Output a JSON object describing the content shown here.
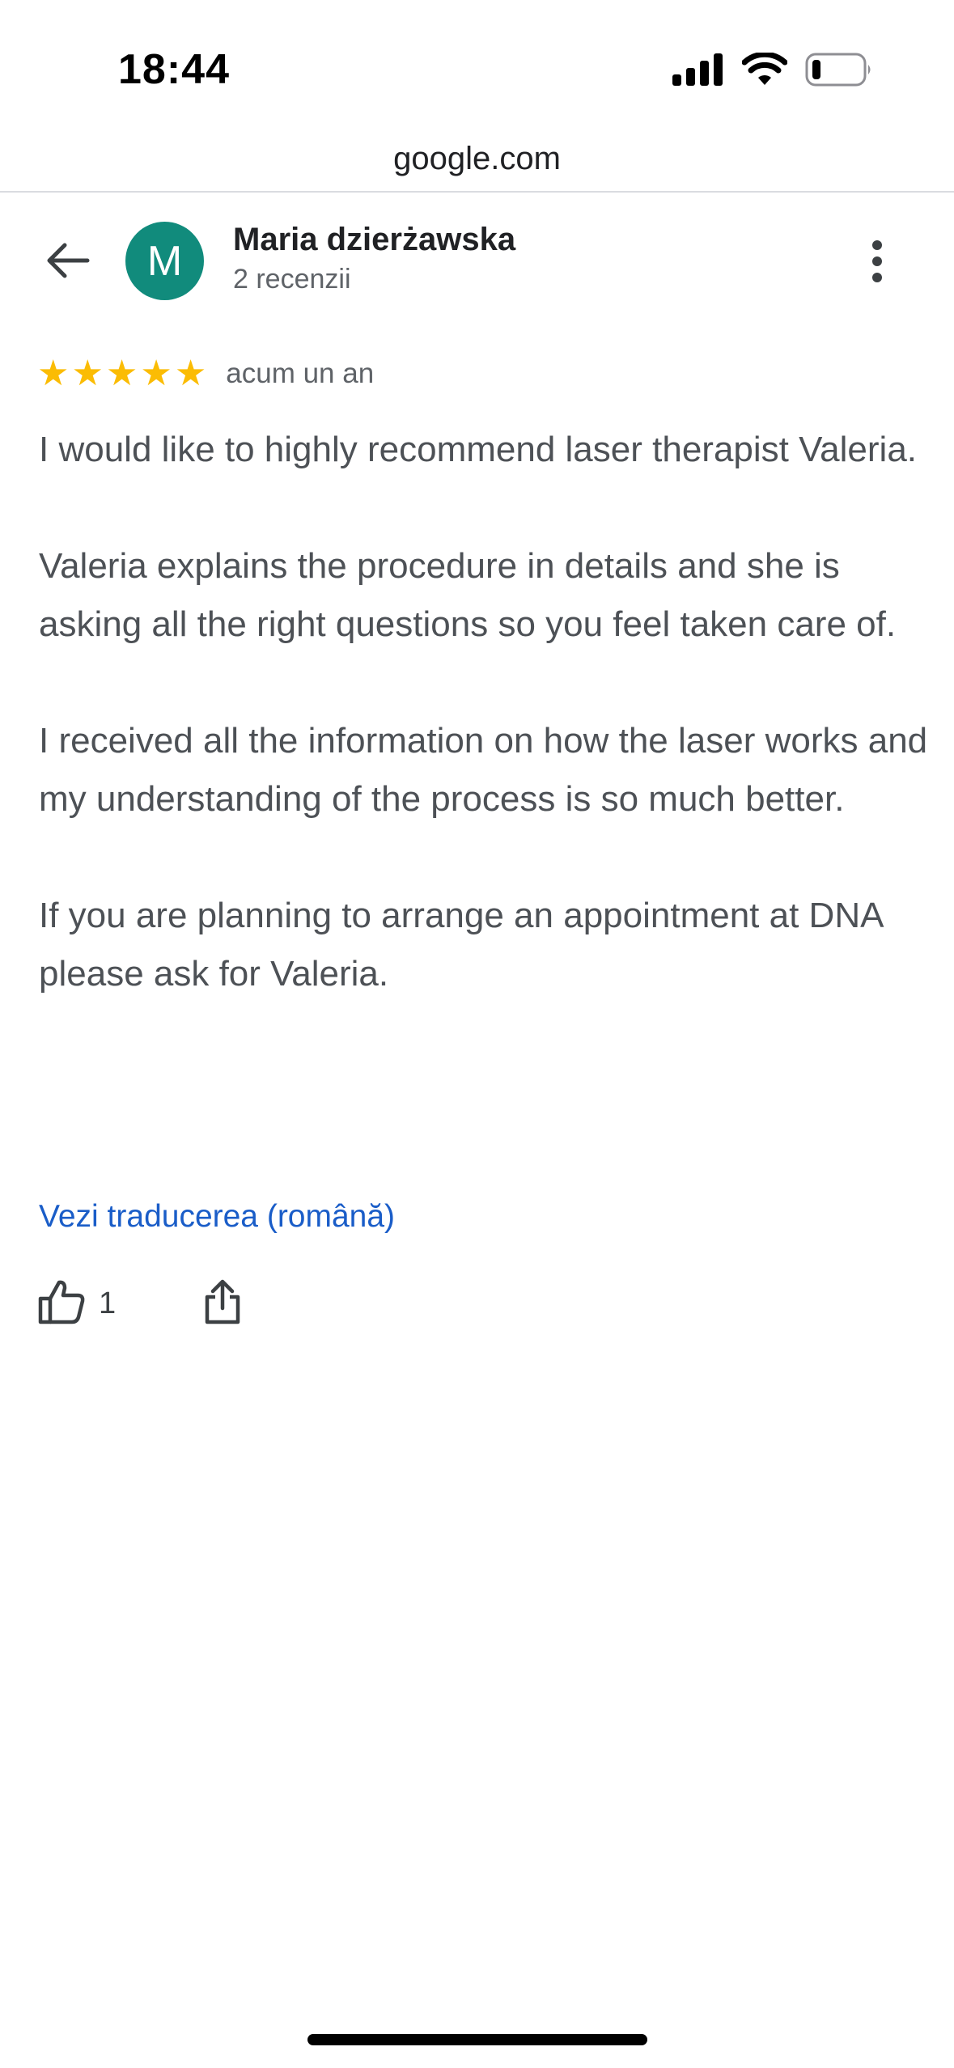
{
  "status_bar": {
    "time": "18:44",
    "icons": [
      "cellular-signal-icon",
      "wifi-icon",
      "battery-icon"
    ]
  },
  "url_bar": {
    "domain": "google.com"
  },
  "header": {
    "back_icon": "arrow-left-icon",
    "avatar_letter": "M",
    "avatar_color": "#118b7c",
    "reviewer_name": "Maria dzierżawska",
    "review_count": "2 recenzii",
    "more_icon": "more-vert-icon"
  },
  "review": {
    "rating": 5,
    "rating_max": 5,
    "star_color": "#fbbc04",
    "date": "acum un an",
    "paragraphs": [
      "I would like to highly recommend laser therapist Valeria.",
      "Valeria explains the procedure in details and she is asking all the right questions so you feel taken care of.",
      "I received all the information on how the laser works and my understanding of the process is so much better.",
      "If you are planning to arrange an appointment at DNA please ask for Valeria."
    ],
    "translate_link": "Vezi traducerea (română)",
    "link_color": "#1a5dc8"
  },
  "actions": {
    "like_icon": "thumbs-up-icon",
    "like_count": "1",
    "share_icon": "share-icon"
  }
}
